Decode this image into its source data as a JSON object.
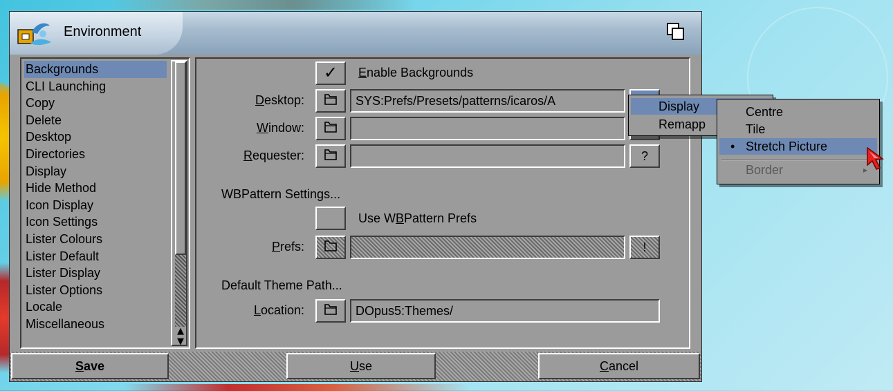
{
  "window": {
    "title": "Environment"
  },
  "categories": [
    "Backgrounds",
    "CLI Launching",
    "Copy",
    "Delete",
    "Desktop",
    "Directories",
    "Display",
    "Hide Method",
    "Icon Display",
    "Icon Settings",
    "Lister Colours",
    "Lister Default",
    "Lister Display",
    "Lister Options",
    "Locale",
    "Miscellaneous"
  ],
  "selected_category": "Backgrounds",
  "backgrounds": {
    "enable": {
      "checked": true,
      "check_glyph": "✓",
      "label_u": "E",
      "label_rest": "nable Backgrounds"
    },
    "desktop": {
      "label_u": "D",
      "label_rest": "esktop:",
      "value": "SYS:Prefs/Presets/patterns/icaros/A"
    },
    "window": {
      "label_u": "W",
      "label_rest": "indow:",
      "value": ""
    },
    "requester": {
      "label_u": "R",
      "label_rest": "equester:",
      "value": "",
      "options_button": "?"
    }
  },
  "wbpattern": {
    "heading": "WBPattern Settings...",
    "use": {
      "checked": false,
      "label_pre": "Use W",
      "label_u": "B",
      "label_post": "Pattern Prefs"
    },
    "prefs": {
      "label_u": "P",
      "label_rest": "refs:",
      "value": "",
      "button": "!",
      "disabled": true
    }
  },
  "theme": {
    "heading": "Default Theme Path...",
    "location": {
      "label_u": "L",
      "label_rest": "ocation:",
      "value": "DOpus5:Themes/"
    }
  },
  "actions": {
    "save": {
      "u": "S",
      "rest": "ave"
    },
    "use": {
      "u": "U",
      "rest": "se"
    },
    "cancel": {
      "u": "C",
      "rest": "ancel"
    }
  },
  "popup_menu": {
    "items": [
      "Display",
      "Remapp"
    ],
    "highlighted": "Display"
  },
  "submenu": {
    "items": [
      {
        "label": "Centre",
        "checked": false
      },
      {
        "label": "Tile",
        "checked": false
      },
      {
        "label": "Stretch Picture",
        "checked": true
      }
    ],
    "check_glyph": "•",
    "border_item": "Border",
    "border_arrow": "▸",
    "highlighted": "Stretch Picture"
  },
  "icons": {
    "title": "dopus-logo-icon",
    "depth": "depth-gadget-icon",
    "folder": "folder-icon",
    "pointer": "mouse-pointer-icon",
    "scroll_up": "▲",
    "scroll_down": "▼"
  },
  "colors": {
    "window_bg": "#9b9b9b",
    "selection": "#6e8ab4",
    "titlebar": "#a7bccf",
    "desktop": "#7ad7ec"
  }
}
